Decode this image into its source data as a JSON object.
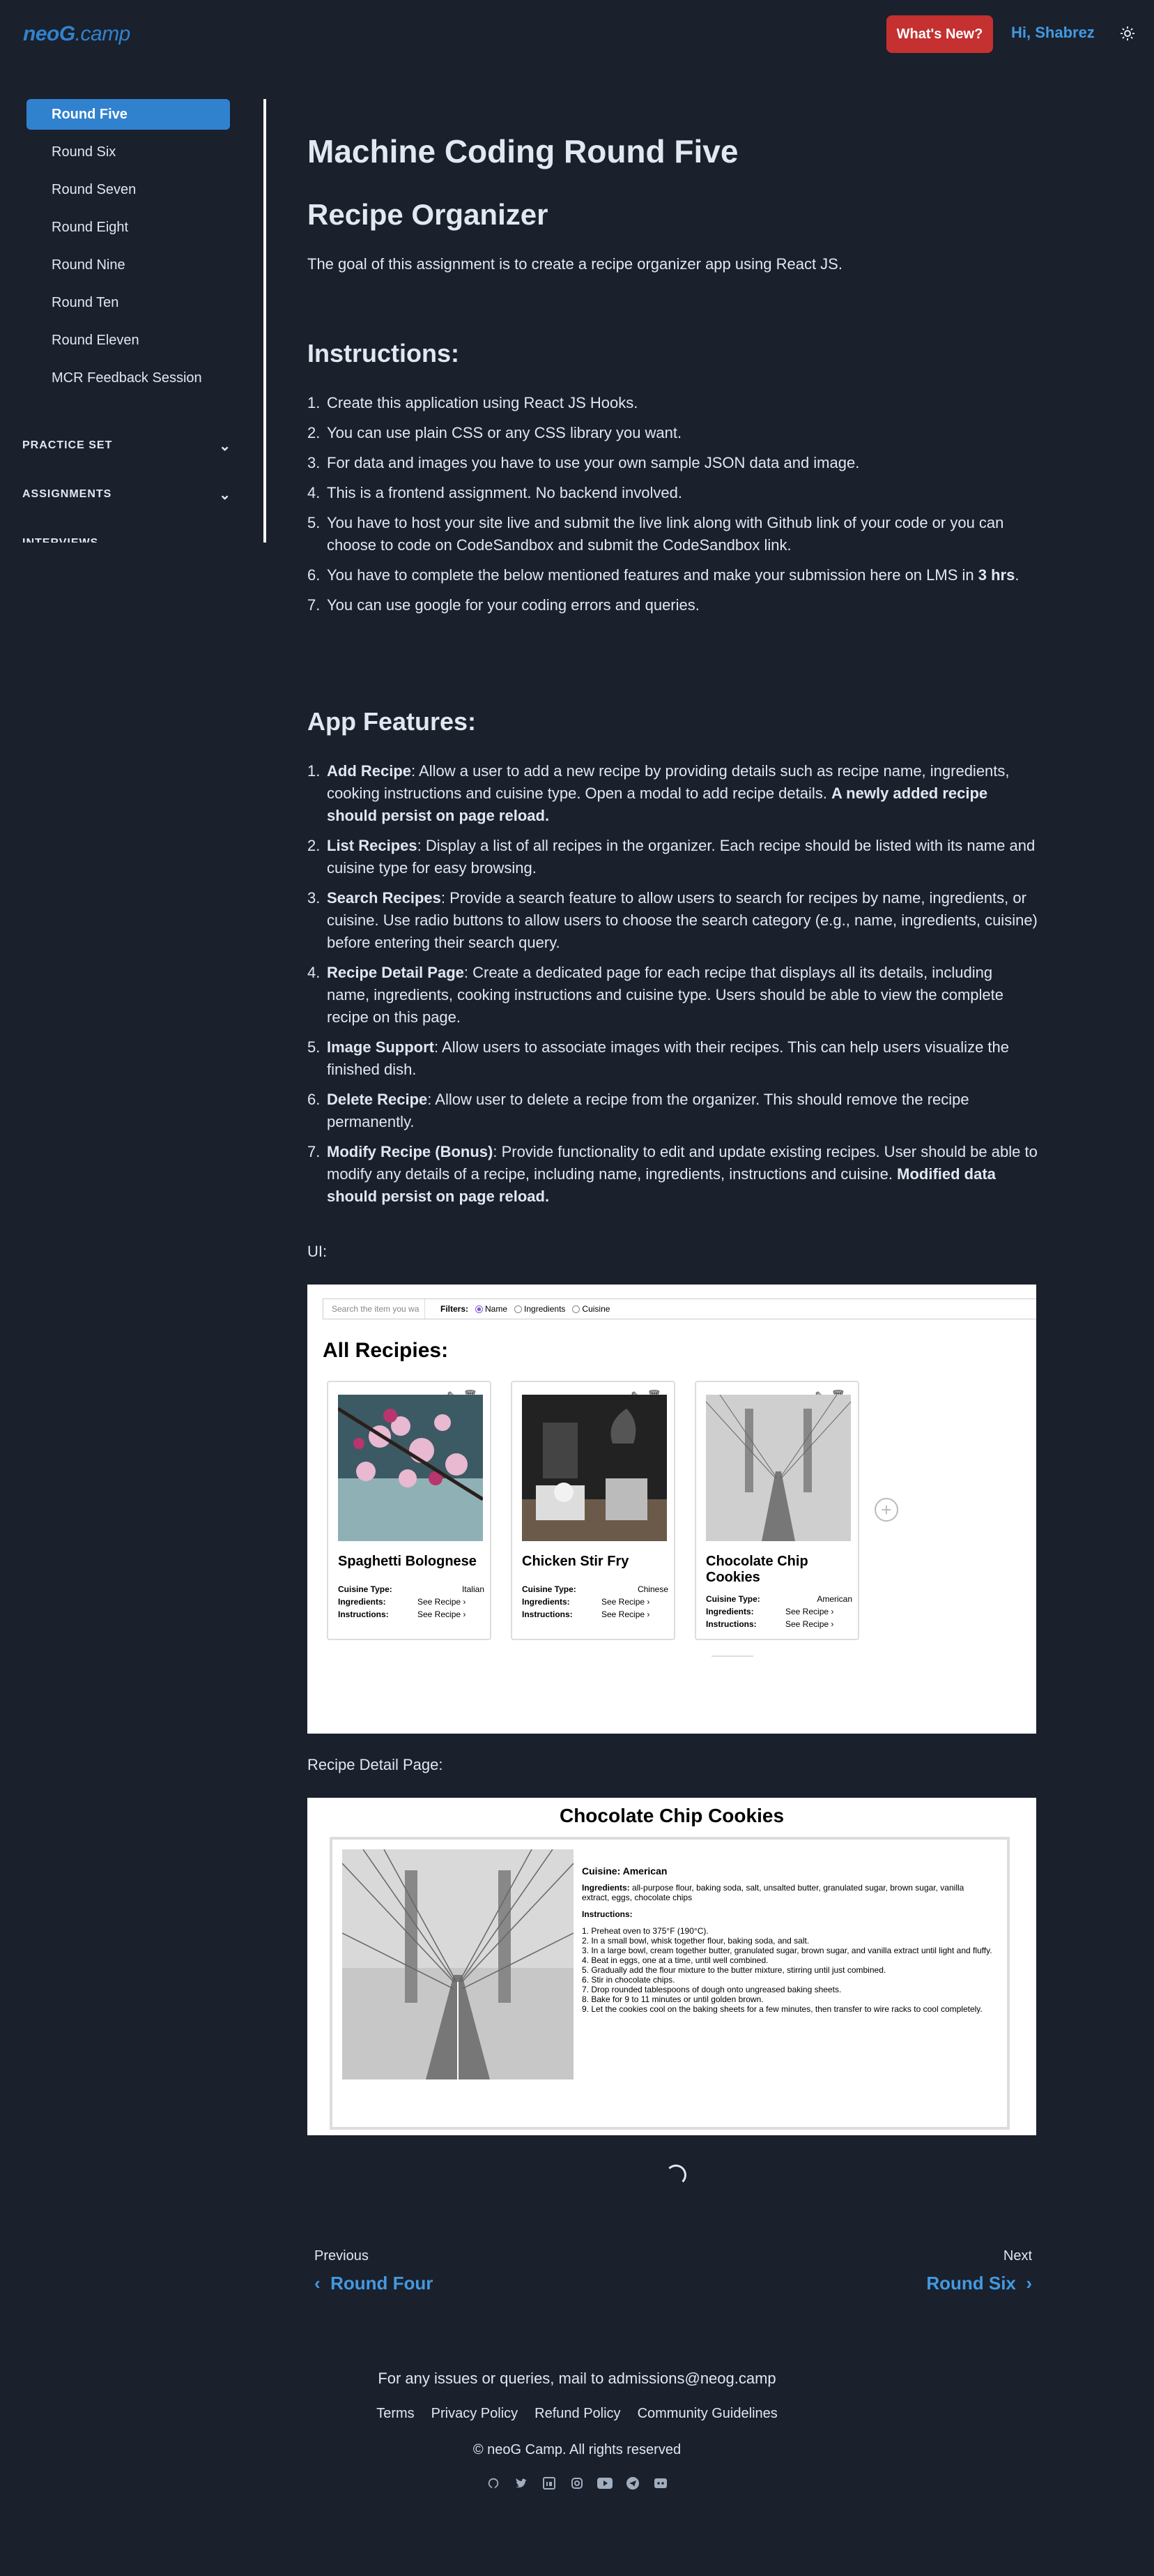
{
  "header": {
    "logo_neog": "neoG",
    "logo_camp": ".camp",
    "whats_new": "What's New?",
    "user": "Hi, Shabrez"
  },
  "sidebar": {
    "items": [
      {
        "label": "Round Five",
        "active": true
      },
      {
        "label": "Round Six"
      },
      {
        "label": "Round Seven"
      },
      {
        "label": "Round Eight"
      },
      {
        "label": "Round Nine"
      },
      {
        "label": "Round Ten"
      },
      {
        "label": "Round Eleven"
      },
      {
        "label": "MCR Feedback Session"
      }
    ],
    "sections": [
      "PRACTICE SET",
      "ASSIGNMENTS",
      "INTERVIEWS"
    ]
  },
  "main": {
    "heading": "Machine Coding Round Five",
    "title": "Recipe Organizer",
    "intro": "The goal of this assignment is to create a recipe organizer app using React JS.",
    "instructions_heading": "Instructions:",
    "instructions": [
      "Create this application using React JS Hooks.",
      "You can use plain CSS or any CSS library you want.",
      "For data and images you have to use your own sample JSON data and image.",
      "This is a frontend assignment. No backend involved.",
      "You have to host your site live and submit the live link along with Github link of your code or you can choose to code on CodeSandbox and submit the CodeSandbox link.",
      "You have to complete the below mentioned features and make your submission here on LMS in ",
      "You can use google for your coding errors and queries."
    ],
    "instructions_bold_tail": "3 hrs",
    "features_heading": "App Features:",
    "features": [
      {
        "name": "Add Recipe",
        "text": ": Allow a user to add a new recipe by providing details such as recipe name, ingredients, cooking instructions and cuisine type. Open a modal to add recipe details. ",
        "bold_tail": "A newly added recipe should persist on page reload."
      },
      {
        "name": "List Recipes",
        "text": ": Display a list of all recipes in the organizer. Each recipe should be listed with its name and cuisine type for easy browsing.",
        "bold_tail": ""
      },
      {
        "name": "Search Recipes",
        "text": ": Provide a search feature to allow users to search for recipes by name, ingredients, or cuisine. Use radio buttons to allow users to choose the search category (e.g., name, ingredients, cuisine) before entering their search query.",
        "bold_tail": ""
      },
      {
        "name": "Recipe Detail Page",
        "text": ": Create a dedicated page for each recipe that displays all its details, including name, ingredients, cooking instructions and cuisine type. Users should be able to view the complete recipe on this page.",
        "bold_tail": ""
      },
      {
        "name": "Image Support",
        "text": ": Allow users to associate images with their recipes. This can help users visualize the finished dish.",
        "bold_tail": ""
      },
      {
        "name": "Delete Recipe",
        "text": ": Allow user to delete a recipe from the organizer. This should remove the recipe permanently.",
        "bold_tail": ""
      },
      {
        "name": "Modify Recipe (Bonus)",
        "text": ": Provide functionality to edit and update existing recipes. User should be able to modify any details of a recipe, including name, ingredients, instructions and cuisine. ",
        "bold_tail": "Modified data should persist on page reload."
      }
    ],
    "ui_label": "UI:",
    "detail_label": "Recipe Detail Page:"
  },
  "mock_ui": {
    "search_placeholder": "Search the item you wa",
    "filters_label": "Filters:",
    "filters": [
      "Name",
      "Ingredients",
      "Cuisine"
    ],
    "all_recipes": "All Recipies:",
    "cuisine_key": "Cuisine Type:",
    "ingredients_key": "Ingredients:",
    "instructions_key": "Instructions:",
    "see_recipe": "See Recipe",
    "cards": [
      {
        "title": "Spaghetti Bolognese",
        "cuisine": "Italian"
      },
      {
        "title": "Chicken Stir Fry",
        "cuisine": "Chinese"
      },
      {
        "title": "Chocolate Chip Cookies",
        "cuisine": "American"
      }
    ]
  },
  "mock_detail": {
    "title": "Chocolate Chip Cookies",
    "cuisine": "Cuisine: American",
    "ingredients_label": "Ingredients:",
    "ingredients": "all-purpose flour, baking soda, salt, unsalted butter, granulated sugar, brown sugar, vanilla extract, eggs, chocolate chips",
    "instructions_label": "Instructions:",
    "steps": [
      "1. Preheat oven to 375°F (190°C).",
      "2. In a small bowl, whisk together flour, baking soda, and salt.",
      "3. In a large bowl, cream together butter, granulated sugar, brown sugar, and vanilla extract until light and fluffy.",
      "4. Beat in eggs, one at a time, until well combined.",
      "5. Gradually add the flour mixture to the butter mixture, stirring until just combined.",
      "6. Stir in chocolate chips.",
      "7. Drop rounded tablespoons of dough onto ungreased baking sheets.",
      "8. Bake for 9 to 11 minutes or until golden brown.",
      "9. Let the cookies cool on the baking sheets for a few minutes, then transfer to wire racks to cool completely."
    ]
  },
  "pager": {
    "prev_label": "Previous",
    "prev_title": "Round Four",
    "next_label": "Next",
    "next_title": "Round Six"
  },
  "footer": {
    "mail": "For any issues or queries, mail to admissions@neog.camp",
    "links": [
      "Terms",
      "Privacy Policy",
      "Refund Policy",
      "Community Guidelines"
    ],
    "copyright": "© neoG Camp. All rights reserved"
  },
  "icons": [
    "github-icon",
    "twitter-icon",
    "linkedin-icon",
    "instagram-icon",
    "youtube-icon",
    "telegram-icon",
    "discord-icon"
  ]
}
